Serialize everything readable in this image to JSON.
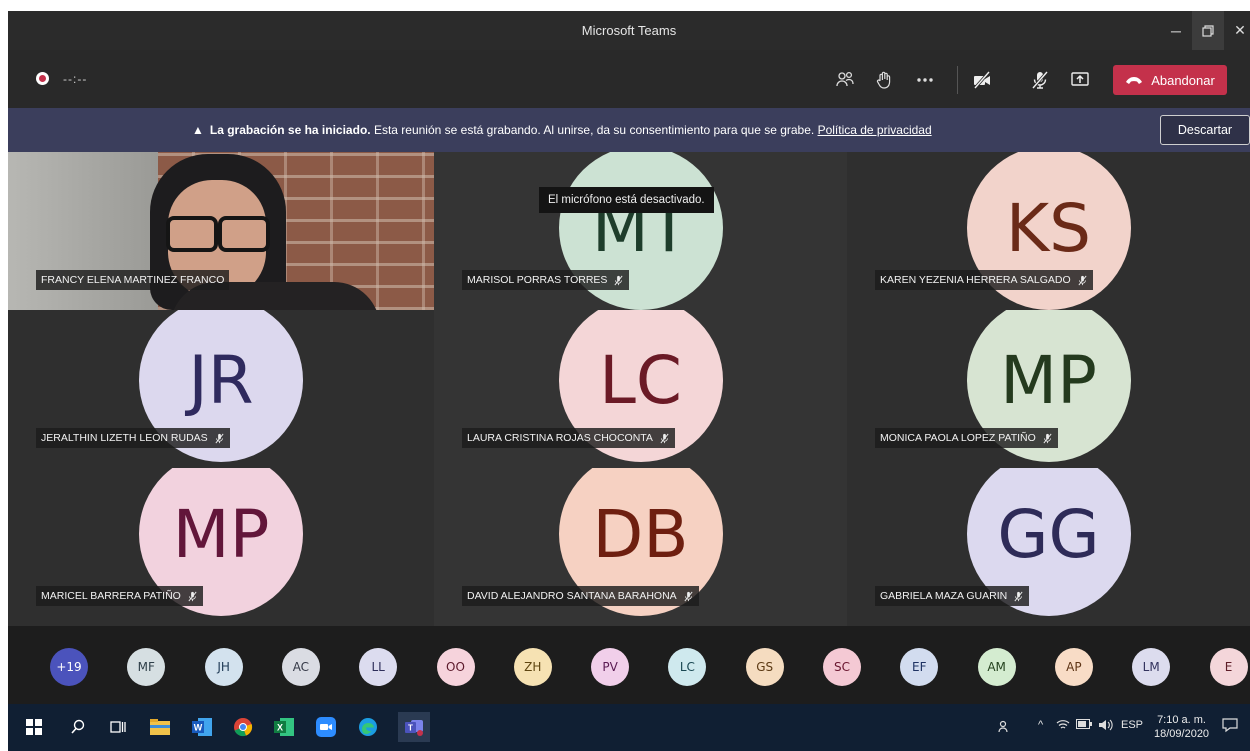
{
  "window": {
    "title": "Microsoft Teams"
  },
  "meeting": {
    "timer": "--:--",
    "leave_label": "Abandonar",
    "tooltip": "El micrófono está desactivado."
  },
  "banner": {
    "bold": "La grabación se ha iniciado.",
    "text": " Esta reunión se está grabando. Al unirse, da su consentimiento para que se grabe. ",
    "link": "Política de privacidad",
    "dismiss": "Descartar"
  },
  "participants": [
    {
      "name": "FRANCY ELENA MARTINEZ FRANCO",
      "initials": "",
      "bg": "",
      "fg": "",
      "video": true
    },
    {
      "name": "MARISOL PORRAS TORRES",
      "initials": "MT",
      "bg": "#cce2d3",
      "fg": "#1e3d2b"
    },
    {
      "name": "KAREN YEZENIA HERRERA SALGADO",
      "initials": "KS",
      "bg": "#f2d3cb",
      "fg": "#6b2a18"
    },
    {
      "name": "JERALTHIN LIZETH LEON RUDAS",
      "initials": "JR",
      "bg": "#dcd8ee",
      "fg": "#2f2a5e"
    },
    {
      "name": "LAURA CRISTINA ROJAS CHOCONTA",
      "initials": "LC",
      "bg": "#f4d6d7",
      "fg": "#6b1a26"
    },
    {
      "name": "MONICA PAOLA LOPEZ PATIÑO",
      "initials": "MP",
      "bg": "#d7e4d2",
      "fg": "#243a1e"
    },
    {
      "name": "MARICEL BARRERA PATIÑO",
      "initials": "MP",
      "bg": "#f2d2de",
      "fg": "#62163a"
    },
    {
      "name": "DAVID ALEJANDRO SANTANA BARAHONA",
      "initials": "DB",
      "bg": "#f6d1c2",
      "fg": "#6e1f10"
    },
    {
      "name": "GABRIELA MAZA GUARIN",
      "initials": "GG",
      "bg": "#dcd9ef",
      "fg": "#2e2b58"
    }
  ],
  "strip": [
    {
      "label": "+19",
      "bg": "#4b53bc",
      "fg": "#ffffff"
    },
    {
      "label": "MF",
      "bg": "#d6dfe2",
      "fg": "#30404a"
    },
    {
      "label": "JH",
      "bg": "#d3e2ee",
      "fg": "#1f3a55"
    },
    {
      "label": "AC",
      "bg": "#dadce3",
      "fg": "#363a48"
    },
    {
      "label": "LL",
      "bg": "#dcdcef",
      "fg": "#2e2e5a"
    },
    {
      "label": "OO",
      "bg": "#f6d3dc",
      "fg": "#5c1a2c"
    },
    {
      "label": "ZH",
      "bg": "#f6e2b3",
      "fg": "#5f4612"
    },
    {
      "label": "PV",
      "bg": "#f1cfea",
      "fg": "#5a1a52"
    },
    {
      "label": "LC",
      "bg": "#cfe9ee",
      "fg": "#1a4752"
    },
    {
      "label": "GS",
      "bg": "#f5dcc0",
      "fg": "#5c3a14"
    },
    {
      "label": "SC",
      "bg": "#f4c9d4",
      "fg": "#6a1730"
    },
    {
      "label": "EF",
      "bg": "#d2dcef",
      "fg": "#1f3363"
    },
    {
      "label": "AM",
      "bg": "#d4ecd0",
      "fg": "#24421e"
    },
    {
      "label": "AP",
      "bg": "#f8dcc6",
      "fg": "#5e3516"
    },
    {
      "label": "LM",
      "bg": "#dcdcee",
      "fg": "#33335e"
    },
    {
      "label": "E",
      "bg": "#f4d6da",
      "fg": "#5e1e28"
    }
  ],
  "taskbar": {
    "language": "ESP",
    "time": "7:10 a. m.",
    "date": "18/09/2020"
  }
}
